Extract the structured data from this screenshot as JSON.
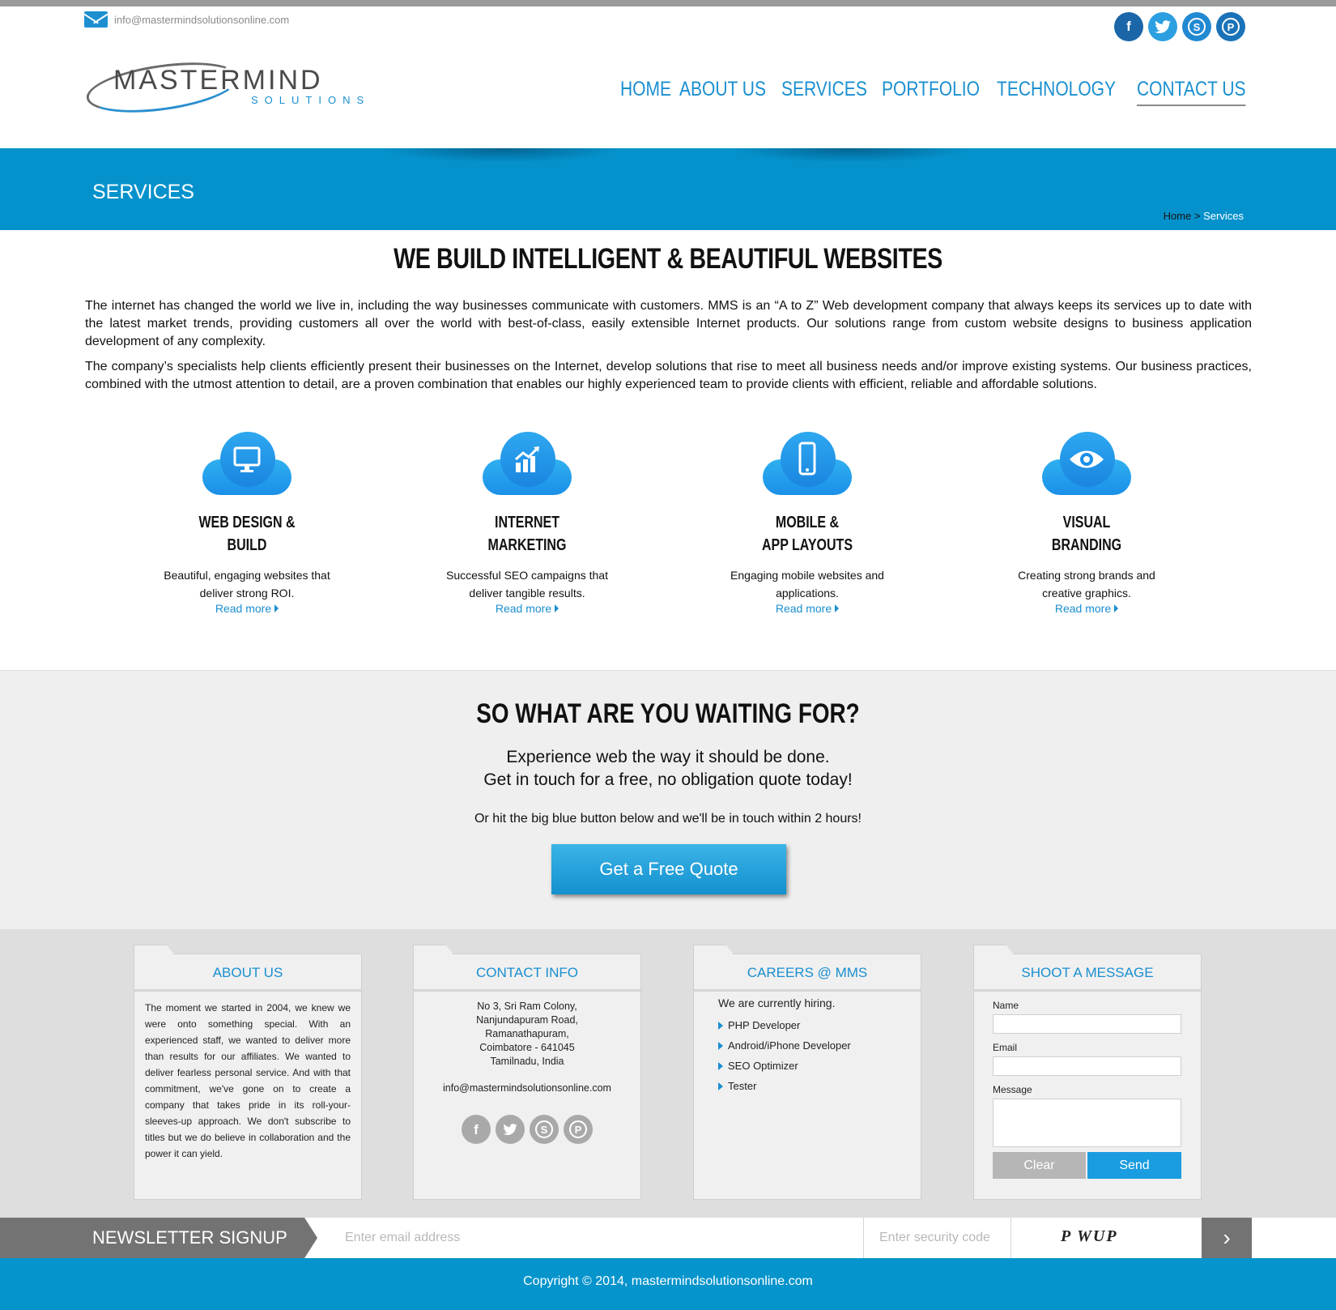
{
  "top": {
    "email": "info@mastermindsolutionsonline.com"
  },
  "social": [
    "facebook-icon",
    "twitter-icon",
    "skype-icon",
    "pinterest-icon"
  ],
  "logo": {
    "main": "MASTERMIND",
    "sub": "SOLUTIONS"
  },
  "nav": [
    {
      "label": "HOME"
    },
    {
      "label": "ABOUT US"
    },
    {
      "label": "SERVICES"
    },
    {
      "label": "PORTFOLIO"
    },
    {
      "label": "TECHNOLOGY"
    },
    {
      "label": "CONTACT US",
      "active": true
    }
  ],
  "banner": {
    "title": "SERVICES",
    "crumb_home": "Home",
    "crumb_sep": " > ",
    "crumb_current": "Services"
  },
  "headline": "WE BUILD INTELLIGENT & BEAUTIFUL WEBSITES",
  "intro": [
    "The internet has changed the world we live in, including the way businesses communicate with customers. MMS is an “A to Z” Web development company that always keeps its services up to date with the latest market trends, providing customers all over the world with best-of-class, easily extensible Internet products. Our solutions range from custom website designs to business application development of any complexity.",
    "The company’s specialists help clients efficiently present their businesses on the Internet, develop solutions that rise to meet all business needs and/or improve existing systems. Our business practices, combined with the utmost attention to detail, are a proven combination that enables our highly experienced team to provide clients with efficient, reliable and affordable solutions."
  ],
  "services": [
    {
      "icon": "monitor-icon",
      "title1": "WEB DESIGN &",
      "title2": "BUILD",
      "desc": "Beautiful, engaging websites that deliver strong ROI.",
      "link": "Read more"
    },
    {
      "icon": "chart-icon",
      "title1": "INTERNET",
      "title2": "MARKETING",
      "desc": "Successful SEO campaigns that deliver tangible results.",
      "link": "Read more"
    },
    {
      "icon": "mobile-icon",
      "title1": "MOBILE &",
      "title2": "APP LAYOUTS",
      "desc": "Engaging mobile websites and applications.",
      "link": "Read more"
    },
    {
      "icon": "eye-icon",
      "title1": "VISUAL",
      "title2": "BRANDING",
      "desc": "Creating strong brands and creative graphics.",
      "link": "Read more"
    }
  ],
  "cta": {
    "heading": "SO WHAT ARE YOU WAITING FOR?",
    "line1": "Experience web the way it should be done.",
    "line2": "Get in touch for a free, no obligation quote today!",
    "line3": "Or hit the big blue button below and we'll be in touch within 2 hours!",
    "button": "Get a Free Quote"
  },
  "footer": {
    "about": {
      "title": "ABOUT US",
      "text": "The moment we started in 2004, we knew we were onto something special. With an experienced staff, we wanted to deliver more than results for our affiliates. We wanted to deliver fearless personal service. And with that commitment, we've gone on to create a company that takes pride in its roll-your-sleeves-up approach. We don't subscribe to titles but we do believe in collaboration and the power it can yield."
    },
    "contact": {
      "title": "CONTACT INFO",
      "addr1": "No 3, Sri Ram Colony,",
      "addr2": "Nanjundapuram Road,",
      "addr3": "Ramanathapuram,",
      "addr4": "Coimbatore - 641045",
      "addr5": "Tamilnadu, India",
      "email": "info@mastermindsolutionsonline.com"
    },
    "careers": {
      "title": "CAREERS @ MMS",
      "intro": "We are currently hiring.",
      "jobs": [
        "PHP Developer",
        "Android/iPhone Developer",
        "SEO Optimizer",
        "Tester"
      ]
    },
    "message": {
      "title": "SHOOT A MESSAGE",
      "name_label": "Name",
      "email_label": "Email",
      "message_label": "Message",
      "clear": "Clear",
      "send": "Send"
    }
  },
  "newsletter": {
    "label": "NEWSLETTER SIGNUP",
    "email_placeholder": "Enter email address",
    "code_placeholder": "Enter security code",
    "captcha": "P WUP"
  },
  "copyright": "Copyright © 2014, mastermindsolutionsonline.com",
  "colors": {
    "accent": "#0594cc",
    "link": "#1a8fd0",
    "cta_bg": "#efefef",
    "footer_bg": "#dedede",
    "newsletter_label_bg": "#737373"
  }
}
